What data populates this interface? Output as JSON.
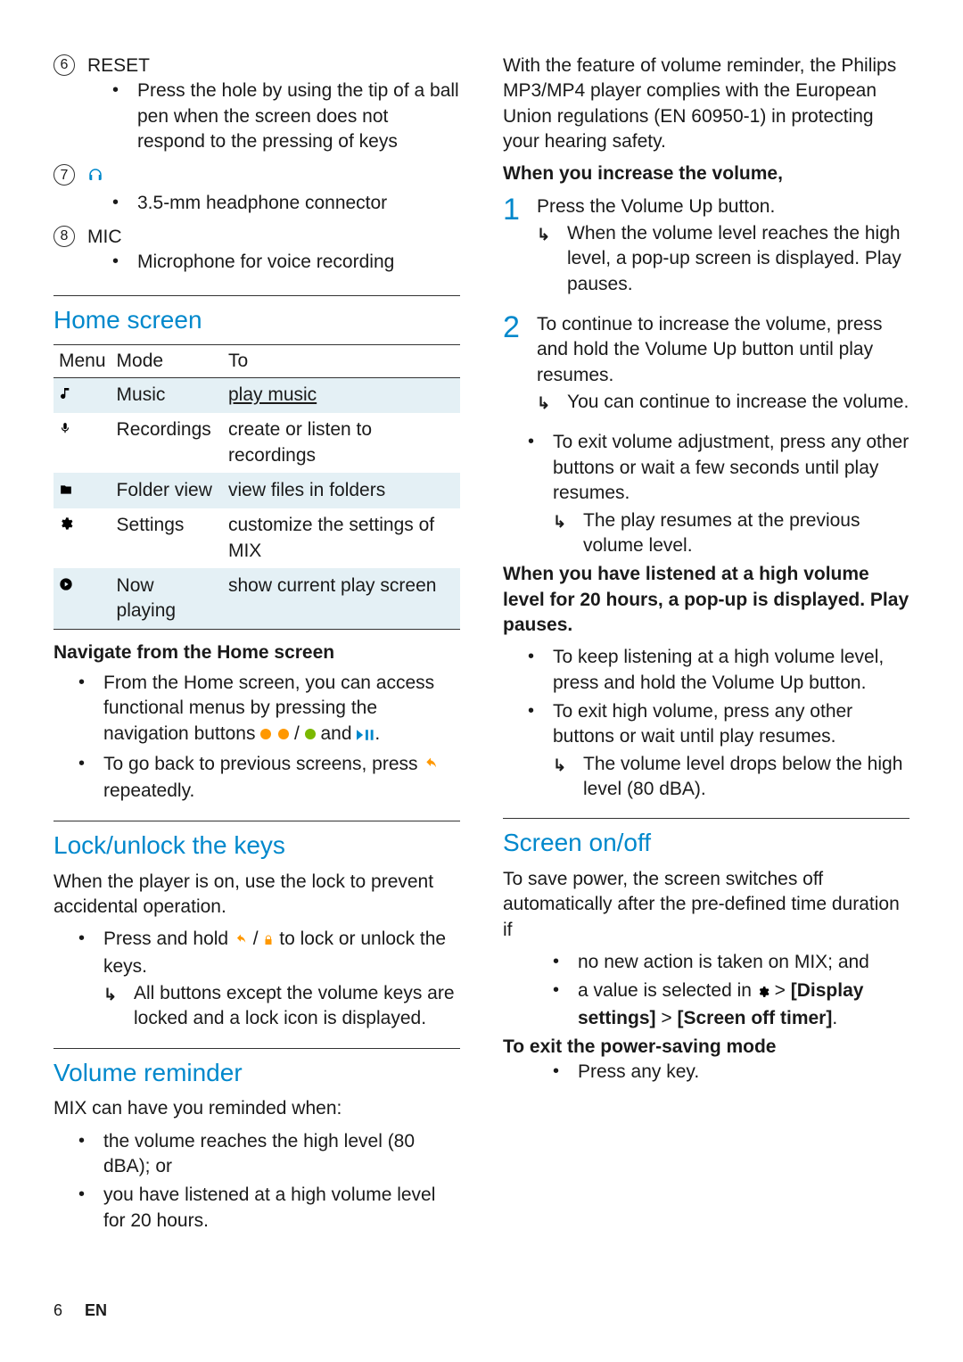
{
  "hardware": [
    {
      "num": "6",
      "label": "RESET",
      "desc": "Press the hole by using the tip of a ball pen when the screen does not respond to the pressing of keys"
    },
    {
      "num": "7",
      "label": "",
      "icon": "headphones",
      "desc": "3.5-mm headphone connector"
    },
    {
      "num": "8",
      "label": "MIC",
      "desc": "Microphone for voice recording"
    }
  ],
  "home": {
    "title": "Home screen",
    "headers": [
      "Menu",
      "Mode",
      "To"
    ],
    "rows": [
      {
        "icon": "music",
        "mode": "Music",
        "to": "play music",
        "link": true
      },
      {
        "icon": "mic",
        "mode": "Recordings",
        "to": "create or listen to recordings"
      },
      {
        "icon": "folder",
        "mode": "Folder view",
        "to": "view files in folders"
      },
      {
        "icon": "gear",
        "mode": "Settings",
        "to": "customize the settings of MIX"
      },
      {
        "icon": "nowplaying",
        "mode": "Now playing",
        "to": "show current play screen"
      }
    ],
    "nav_title": "Navigate from the Home screen",
    "nav_b1a": "From the Home screen, you can access functional menus by pressing the navigation buttons ",
    "nav_b1b": " and ",
    "nav_b2a": "To go back to previous screens, press ",
    "nav_b2b": " repeatedly."
  },
  "lock": {
    "title": "Lock/unlock the keys",
    "intro": "When the player is on, use the lock to prevent accidental operation.",
    "b1a": "Press and hold ",
    "b1b": " to lock or unlock the keys.",
    "sub": "All buttons except the volume keys are locked and a lock icon is displayed."
  },
  "volume": {
    "title": "Volume reminder",
    "intro": "MIX can have you reminded when:",
    "b1": "the volume reaches the high level (80 dBA); or",
    "b2": "you have listened at a high volume level for 20 hours."
  },
  "right": {
    "compliance": "With the feature of volume reminder, the Philips MP3/MP4 player complies with the European Union regulations (EN 60950-1) in protecting your hearing safety.",
    "inc_title": "When you increase the volume,",
    "step1": "Press the Volume Up button.",
    "step1_sub": "When the volume level reaches the high level, a pop-up screen is displayed. Play pauses.",
    "step2": "To continue to increase the volume, press and hold the Volume Up button until play resumes.",
    "step2_sub": "You can continue to increase the volume.",
    "exit_b": "To exit volume adjustment, press any other buttons or wait a few seconds until play resumes.",
    "exit_sub": "The play resumes at the previous volume level.",
    "high_title": "When you have listened at a high volume level for 20 hours, a pop-up is displayed. Play pauses.",
    "high_b1": "To keep listening at a high volume level, press and hold the Volume Up button.",
    "high_b2": "To exit high volume, press any other buttons or wait until play resumes.",
    "high_sub": "The volume level drops below the high level (80 dBA)."
  },
  "screen": {
    "title": "Screen on/off",
    "intro": "To save power, the screen switches off automatically after the pre-defined time duration if",
    "b1": "no new action is taken on MIX; and",
    "b2a": "a value is selected in ",
    "b2b": " > ",
    "path1": "[Display settings]",
    "path2": "[Screen off timer]",
    "exit_title": "To exit the power-saving mode",
    "exit_b": "Press any key."
  },
  "footer": {
    "page": "6",
    "lang": "EN"
  }
}
